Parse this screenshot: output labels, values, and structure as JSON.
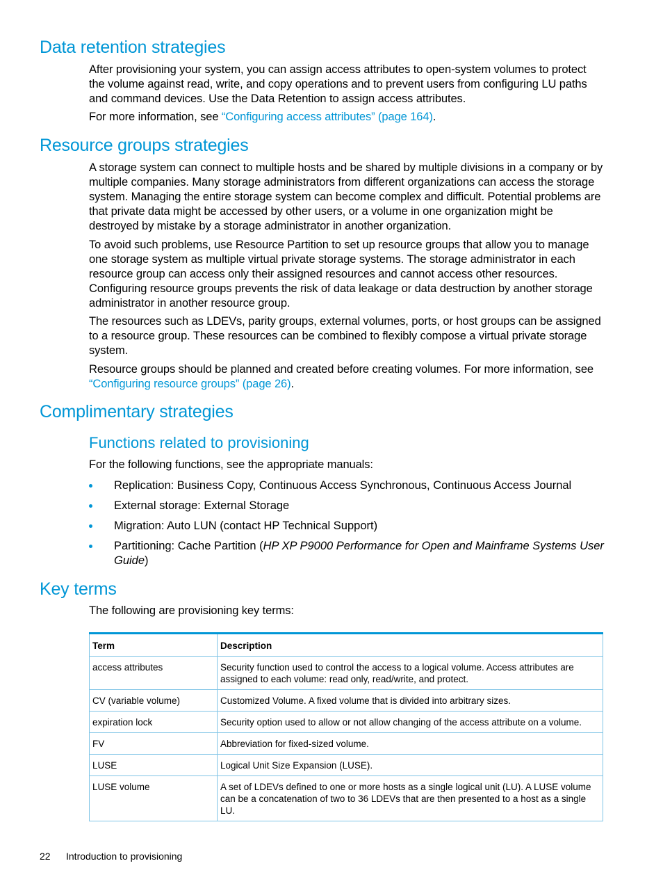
{
  "sections": {
    "data_retention": {
      "heading": "Data retention strategies",
      "para1": "After provisioning your system, you can assign access attributes to open-system volumes to protect the volume against read, write, and copy operations and to prevent users from configuring LU paths and command devices. Use the Data Retention to assign access attributes.",
      "para2_prefix": "For more information, see ",
      "para2_link": "“Configuring access attributes” (page 164)",
      "para2_suffix": "."
    },
    "resource_groups": {
      "heading": "Resource groups strategies",
      "para1": "A storage system can connect to multiple hosts and be shared by multiple divisions in a company or by multiple companies. Many storage administrators from different organizations can access the storage system. Managing the entire storage system can become complex and difficult. Potential problems are that private data might be accessed by other users, or a volume in one organization might be destroyed by mistake by a storage administrator in another organization.",
      "para2": "To avoid such problems, use Resource Partition to set up resource groups that allow you to manage one storage system as multiple virtual private storage systems. The storage administrator in each resource group can access only their assigned resources and cannot access other resources. Configuring resource groups prevents the risk of data leakage or data destruction by another storage administrator in another resource group.",
      "para3": "The resources such as LDEVs, parity groups, external volumes, ports, or host groups can be assigned to a resource group. These resources can be combined to flexibly compose a virtual private storage system.",
      "para4_prefix": "Resource groups should be planned and created before creating volumes. For more information, see ",
      "para4_link": "“Configuring resource groups” (page 26)",
      "para4_suffix": "."
    },
    "complimentary": {
      "heading": "Complimentary strategies",
      "subheading": "Functions related to provisioning",
      "intro": "For the following functions, see the appropriate manuals:",
      "bullets": [
        "Replication: Business Copy, Continuous Access Synchronous, Continuous Access Journal",
        "External storage: External Storage",
        "Migration: Auto LUN (contact HP Technical Support)"
      ],
      "bullet4_prefix": "Partitioning: Cache Partition (",
      "bullet4_italic": "HP XP P9000 Performance for Open and Mainframe Systems User Guide",
      "bullet4_suffix": ")"
    },
    "key_terms": {
      "heading": "Key terms",
      "intro": "The following are provisioning key terms:",
      "table": {
        "headers": [
          "Term",
          "Description"
        ],
        "rows": [
          [
            "access attributes",
            "Security function used to control the access to a logical volume. Access attributes are assigned to each volume: read only, read/write, and protect."
          ],
          [
            "CV (variable volume)",
            "Customized Volume. A fixed volume that is divided into arbitrary sizes."
          ],
          [
            "expiration lock",
            "Security option used to allow or not allow changing of the access attribute on a volume."
          ],
          [
            "FV",
            "Abbreviation for fixed-sized volume."
          ],
          [
            "LUSE",
            "Logical Unit Size Expansion (LUSE)."
          ],
          [
            "LUSE volume",
            "A set of LDEVs defined to one or more hosts as a single logical unit (LU). A LUSE volume can be a concatenation of two to 36 LDEVs that are then presented to a host as a single LU."
          ]
        ]
      }
    }
  },
  "footer": {
    "page_number": "22",
    "chapter": "Introduction to provisioning"
  },
  "colors": {
    "accent": "#0096d6",
    "table_border": "#7fc4e6"
  }
}
